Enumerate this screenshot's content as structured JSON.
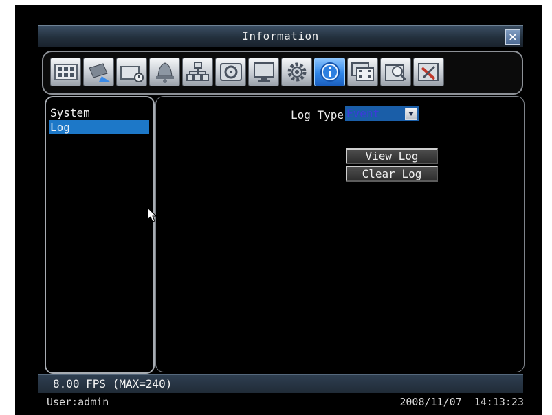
{
  "window": {
    "title": "Information",
    "close_icon": "close-icon"
  },
  "toolbar": {
    "icons": [
      "camera-grid-icon",
      "ptz-camera-icon",
      "record-schedule-icon",
      "alarm-bell-icon",
      "network-icon",
      "disk-icon",
      "monitor-display-icon",
      "settings-gear-icon",
      "information-icon",
      "film-roll-icon",
      "search-icon",
      "tools-icon"
    ],
    "active": "information-icon"
  },
  "sidebar": {
    "items": [
      {
        "label": "System",
        "selected": false
      },
      {
        "label": "Log",
        "selected": true
      }
    ]
  },
  "main": {
    "log_type_label": "Log Type",
    "log_type_value": "Event",
    "view_log_label": "View Log",
    "clear_log_label": "Clear Log"
  },
  "status": {
    "fps": "8.00 FPS (MAX=240)",
    "user": "User:admin",
    "date": "2008/11/07",
    "time": "14:13:23"
  },
  "colors": {
    "selection": "#1d78c8",
    "title_bar": "#2b3946",
    "active_tool": "#2f86e8"
  }
}
